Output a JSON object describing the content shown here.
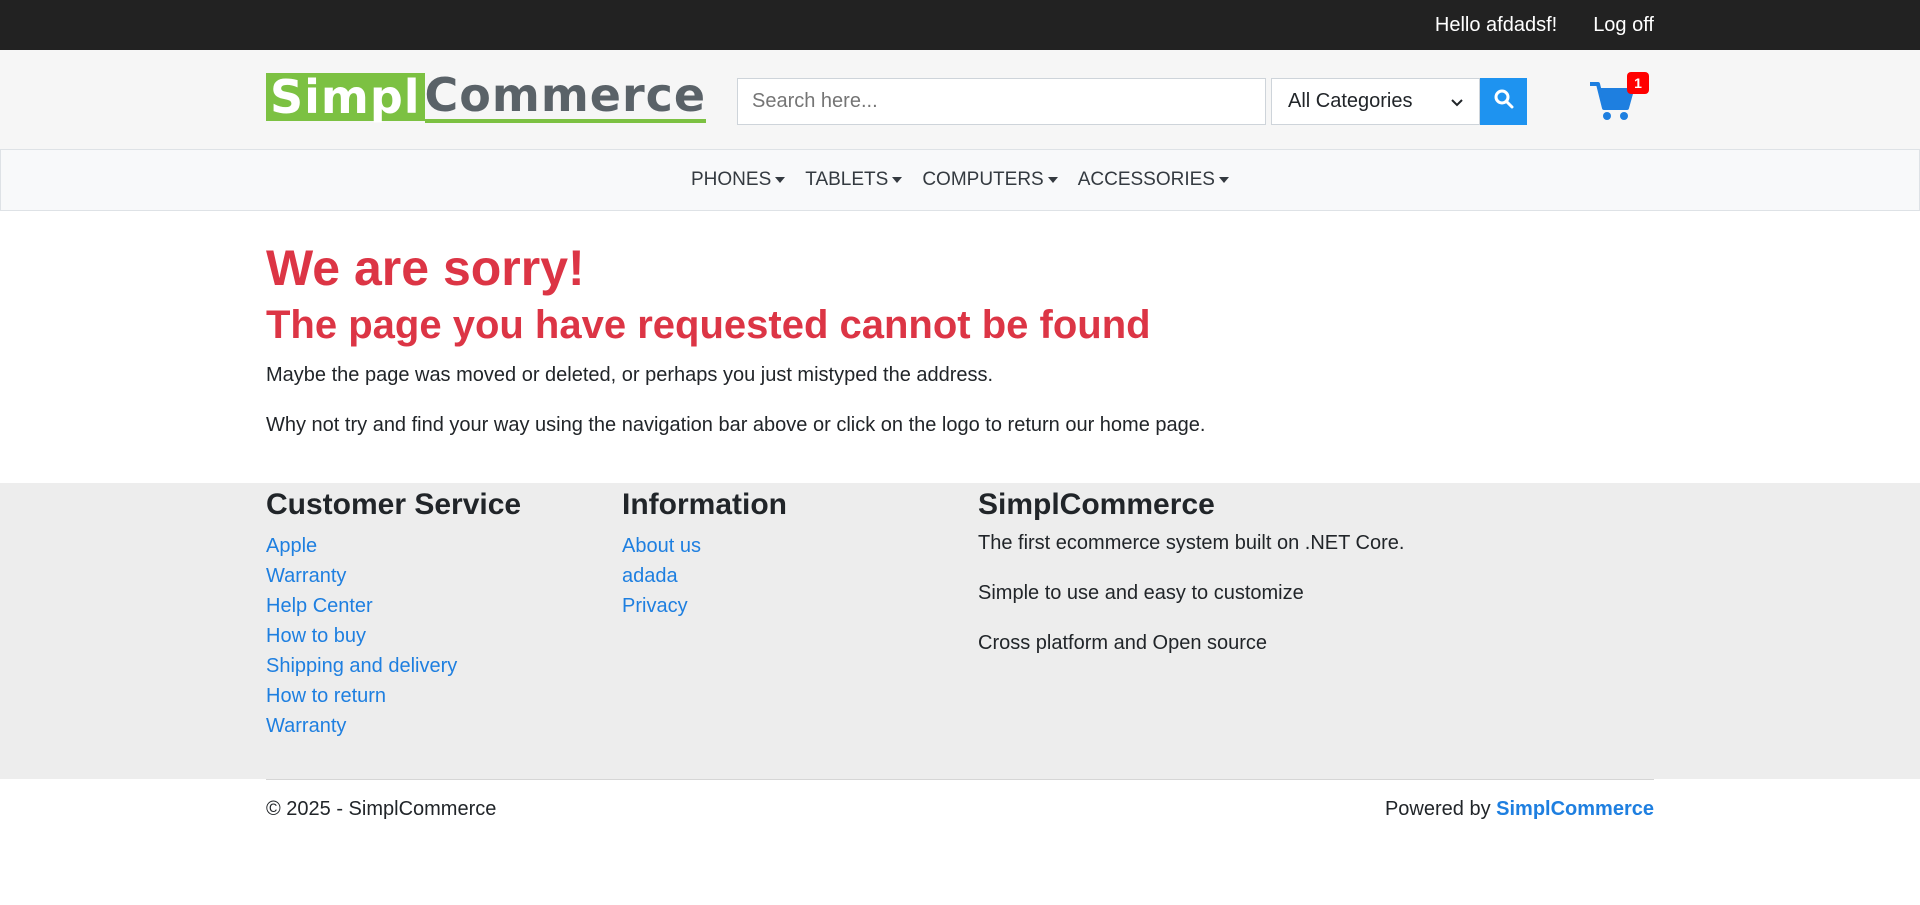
{
  "topbar": {
    "greeting": "Hello afdadsf!",
    "logoff": "Log off"
  },
  "header": {
    "logo_part1": "Simpl",
    "logo_part2": "Commerce",
    "search_placeholder": "Search here...",
    "category_selected": "All Categories",
    "search_icon": "search-icon",
    "cart_icon": "shopping-cart-icon",
    "cart_count": "1"
  },
  "nav": {
    "items": [
      {
        "label": "PHONES"
      },
      {
        "label": "TABLETS"
      },
      {
        "label": "COMPUTERS"
      },
      {
        "label": "ACCESSORIES"
      }
    ]
  },
  "main": {
    "title": "We are sorry!",
    "subtitle": "The page you have requested cannot be found",
    "line1": "Maybe the page was moved or deleted, or perhaps you just mistyped the address.",
    "line2": "Why not try and find your way using the navigation bar above or click on the logo to return our home page."
  },
  "footer": {
    "customer_service": {
      "heading": "Customer Service",
      "links": [
        "Apple",
        "Warranty",
        "Help Center",
        "How to buy",
        "Shipping and delivery",
        "How to return",
        "Warranty"
      ]
    },
    "information": {
      "heading": "Information",
      "links": [
        "About us",
        "adada",
        "Privacy"
      ]
    },
    "about": {
      "heading": "SimplCommerce",
      "lines": [
        "The first ecommerce system built on .NET Core.",
        "Simple to use and easy to customize",
        "Cross platform and Open source"
      ]
    }
  },
  "bottom": {
    "copyright": "© 2025 - SimplCommerce",
    "powered_prefix": "Powered by",
    "powered_brand": "SimplCommerce"
  },
  "colors": {
    "accent": "#1e93f0",
    "logo_green": "#7cc142",
    "error_red": "#dc3545",
    "topbar": "#222222",
    "footer_bg": "#ededed"
  }
}
